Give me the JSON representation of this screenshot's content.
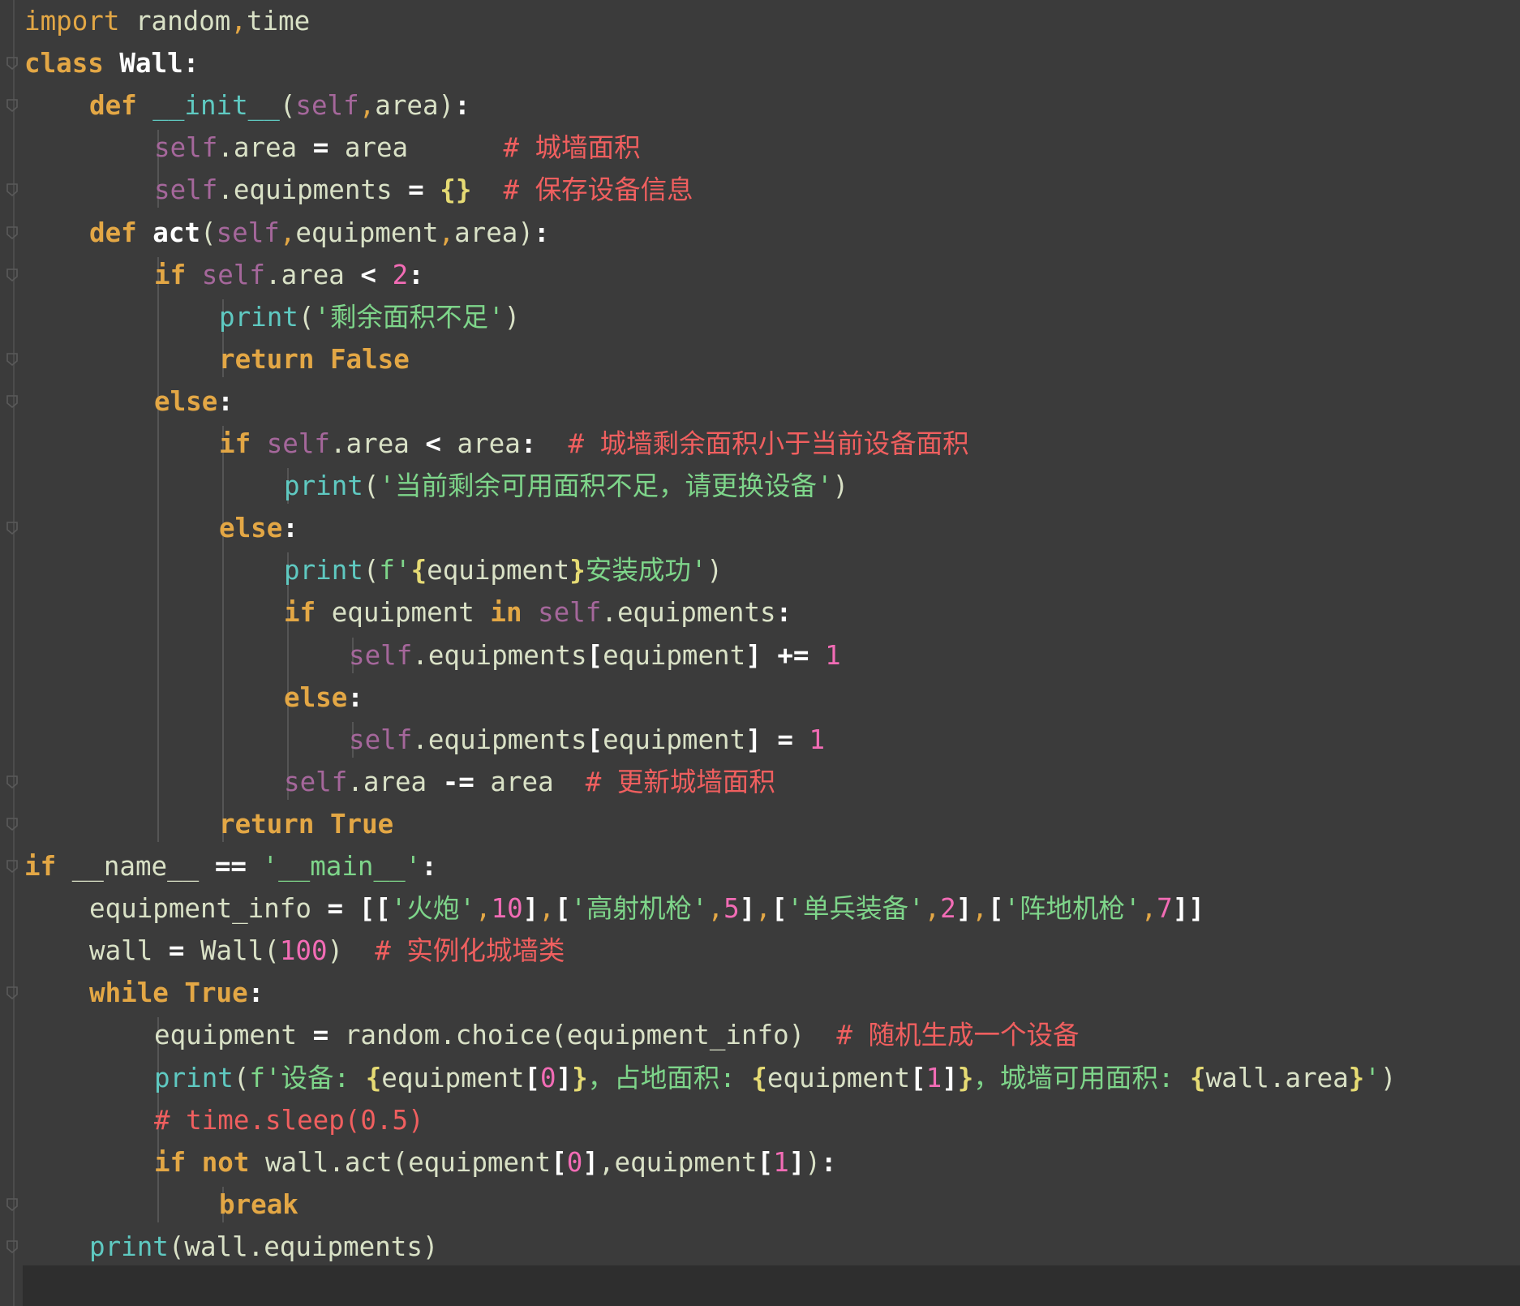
{
  "editor": {
    "language": "python",
    "theme_colors": {
      "background": "#3b3b3b",
      "keyword": "#e3a745",
      "self": "#a5679b",
      "builtin": "#5fc9c1",
      "string": "#7ed58a",
      "number": "#f26cb5",
      "comment": "#f05f5f",
      "default": "#d9e1c6"
    },
    "lines": [
      {
        "indent": 0,
        "segments": [
          [
            "kw2",
            "import"
          ],
          [
            "dn",
            " random"
          ],
          [
            "kw2",
            ","
          ],
          [
            "dn",
            "time"
          ]
        ]
      },
      {
        "indent": 0,
        "segments": [
          [
            "kw",
            "class"
          ],
          [
            "dn",
            " "
          ],
          [
            "cls",
            "Wall"
          ],
          [
            "op",
            ":"
          ]
        ]
      },
      {
        "indent": 1,
        "segments": [
          [
            "kw",
            "def"
          ],
          [
            "dn",
            " "
          ],
          [
            "fn",
            "__init__"
          ],
          [
            "dn",
            "("
          ],
          [
            "slf",
            "self"
          ],
          [
            "kw2",
            ","
          ],
          [
            "dn",
            "area"
          ],
          [
            "dn",
            ")"
          ],
          [
            "op",
            ":"
          ]
        ]
      },
      {
        "indent": 2,
        "segments": [
          [
            "slf",
            "self"
          ],
          [
            "dn",
            ".area "
          ],
          [
            "op",
            "="
          ],
          [
            "dn",
            " area      "
          ],
          [
            "cm",
            "# 城墙面积"
          ]
        ]
      },
      {
        "indent": 2,
        "segments": [
          [
            "slf",
            "self"
          ],
          [
            "dn",
            ".equipments "
          ],
          [
            "op",
            "="
          ],
          [
            "dn",
            " "
          ],
          [
            "brace",
            "{}"
          ],
          [
            "dn",
            "  "
          ],
          [
            "cm",
            "# 保存设备信息"
          ]
        ]
      },
      {
        "indent": 1,
        "segments": [
          [
            "kw",
            "def"
          ],
          [
            "dn",
            " "
          ],
          [
            "call",
            "act"
          ],
          [
            "dn",
            "("
          ],
          [
            "slf",
            "self"
          ],
          [
            "kw2",
            ","
          ],
          [
            "dn",
            "equipment"
          ],
          [
            "kw2",
            ","
          ],
          [
            "dn",
            "area"
          ],
          [
            "dn",
            ")"
          ],
          [
            "op",
            ":"
          ]
        ]
      },
      {
        "indent": 2,
        "segments": [
          [
            "kw",
            "if"
          ],
          [
            "dn",
            " "
          ],
          [
            "slf",
            "self"
          ],
          [
            "dn",
            ".area "
          ],
          [
            "op",
            "<"
          ],
          [
            "dn",
            " "
          ],
          [
            "num",
            "2"
          ],
          [
            "op",
            ":"
          ]
        ]
      },
      {
        "indent": 3,
        "segments": [
          [
            "fn",
            "print"
          ],
          [
            "dn",
            "("
          ],
          [
            "str",
            "'剩余面积不足'"
          ],
          [
            "dn",
            ")"
          ]
        ]
      },
      {
        "indent": 3,
        "segments": [
          [
            "kw",
            "return"
          ],
          [
            "dn",
            " "
          ],
          [
            "kw",
            "False"
          ]
        ]
      },
      {
        "indent": 2,
        "segments": [
          [
            "kw",
            "else"
          ],
          [
            "op",
            ":"
          ]
        ]
      },
      {
        "indent": 3,
        "segments": [
          [
            "kw",
            "if"
          ],
          [
            "dn",
            " "
          ],
          [
            "slf",
            "self"
          ],
          [
            "dn",
            ".area "
          ],
          [
            "op",
            "<"
          ],
          [
            "dn",
            " area"
          ],
          [
            "op",
            ":"
          ],
          [
            "dn",
            "  "
          ],
          [
            "cm",
            "# 城墙剩余面积小于当前设备面积"
          ]
        ]
      },
      {
        "indent": 4,
        "segments": [
          [
            "fn",
            "print"
          ],
          [
            "dn",
            "("
          ],
          [
            "str",
            "'当前剩余可用面积不足，请更换设备'"
          ],
          [
            "dn",
            ")"
          ]
        ]
      },
      {
        "indent": 3,
        "segments": [
          [
            "kw",
            "else"
          ],
          [
            "op",
            ":"
          ]
        ]
      },
      {
        "indent": 4,
        "segments": [
          [
            "fn",
            "print"
          ],
          [
            "dn",
            "("
          ],
          [
            "str",
            "f'"
          ],
          [
            "brace",
            "{"
          ],
          [
            "dn",
            "equipment"
          ],
          [
            "brace",
            "}"
          ],
          [
            "str",
            "安装成功'"
          ],
          [
            "dn",
            ")"
          ]
        ]
      },
      {
        "indent": 4,
        "segments": [
          [
            "kw",
            "if"
          ],
          [
            "dn",
            " equipment "
          ],
          [
            "kw",
            "in"
          ],
          [
            "dn",
            " "
          ],
          [
            "slf",
            "self"
          ],
          [
            "dn",
            ".equipments"
          ],
          [
            "op",
            ":"
          ]
        ]
      },
      {
        "indent": 5,
        "segments": [
          [
            "slf",
            "self"
          ],
          [
            "dn",
            ".equipments"
          ],
          [
            "op",
            "["
          ],
          [
            "dn",
            "equipment"
          ],
          [
            "op",
            "]"
          ],
          [
            "dn",
            " "
          ],
          [
            "op",
            "+="
          ],
          [
            "dn",
            " "
          ],
          [
            "num",
            "1"
          ]
        ]
      },
      {
        "indent": 4,
        "segments": [
          [
            "kw",
            "else"
          ],
          [
            "op",
            ":"
          ]
        ]
      },
      {
        "indent": 5,
        "segments": [
          [
            "slf",
            "self"
          ],
          [
            "dn",
            ".equipments"
          ],
          [
            "op",
            "["
          ],
          [
            "dn",
            "equipment"
          ],
          [
            "op",
            "]"
          ],
          [
            "dn",
            " "
          ],
          [
            "op",
            "="
          ],
          [
            "dn",
            " "
          ],
          [
            "num",
            "1"
          ]
        ]
      },
      {
        "indent": 4,
        "segments": [
          [
            "slf",
            "self"
          ],
          [
            "dn",
            ".area "
          ],
          [
            "op",
            "-="
          ],
          [
            "dn",
            " area  "
          ],
          [
            "cm",
            "# 更新城墙面积"
          ]
        ]
      },
      {
        "indent": 3,
        "segments": [
          [
            "kw",
            "return"
          ],
          [
            "dn",
            " "
          ],
          [
            "kw",
            "True"
          ]
        ]
      },
      {
        "indent": 0,
        "segments": [
          [
            "kw",
            "if"
          ],
          [
            "dn",
            " __name__ "
          ],
          [
            "op",
            "=="
          ],
          [
            "dn",
            " "
          ],
          [
            "str",
            "'__main__'"
          ],
          [
            "op",
            ":"
          ]
        ]
      },
      {
        "indent": 1,
        "segments": [
          [
            "dn",
            "equipment_info "
          ],
          [
            "op",
            "="
          ],
          [
            "dn",
            " "
          ],
          [
            "op",
            "[["
          ],
          [
            "str",
            "'火炮'"
          ],
          [
            "kw2",
            ","
          ],
          [
            "num",
            "10"
          ],
          [
            "op",
            "]"
          ],
          [
            "kw2",
            ","
          ],
          [
            "op",
            "["
          ],
          [
            "str",
            "'高射机枪'"
          ],
          [
            "kw2",
            ","
          ],
          [
            "num",
            "5"
          ],
          [
            "op",
            "]"
          ],
          [
            "kw2",
            ","
          ],
          [
            "op",
            "["
          ],
          [
            "str",
            "'单兵装备'"
          ],
          [
            "kw2",
            ","
          ],
          [
            "num",
            "2"
          ],
          [
            "op",
            "]"
          ],
          [
            "kw2",
            ","
          ],
          [
            "op",
            "["
          ],
          [
            "str",
            "'阵地机枪'"
          ],
          [
            "kw2",
            ","
          ],
          [
            "num",
            "7"
          ],
          [
            "op",
            "]]"
          ]
        ]
      },
      {
        "indent": 1,
        "segments": [
          [
            "dn",
            "wall "
          ],
          [
            "op",
            "="
          ],
          [
            "dn",
            " Wall("
          ],
          [
            "num",
            "100"
          ],
          [
            "dn",
            ")  "
          ],
          [
            "cm",
            "# 实例化城墙类"
          ]
        ]
      },
      {
        "indent": 1,
        "segments": [
          [
            "kw",
            "while"
          ],
          [
            "dn",
            " "
          ],
          [
            "kw",
            "True"
          ],
          [
            "op",
            ":"
          ]
        ]
      },
      {
        "indent": 2,
        "segments": [
          [
            "dn",
            "equipment "
          ],
          [
            "op",
            "="
          ],
          [
            "dn",
            " random.choice(equipment_info)  "
          ],
          [
            "cm",
            "# 随机生成一个设备"
          ]
        ]
      },
      {
        "indent": 2,
        "segments": [
          [
            "fn",
            "print"
          ],
          [
            "dn",
            "("
          ],
          [
            "str",
            "f'设备: "
          ],
          [
            "brace",
            "{"
          ],
          [
            "dn",
            "equipment"
          ],
          [
            "op",
            "["
          ],
          [
            "num",
            "0"
          ],
          [
            "op",
            "]"
          ],
          [
            "brace",
            "}"
          ],
          [
            "str",
            "，占地面积: "
          ],
          [
            "brace",
            "{"
          ],
          [
            "dn",
            "equipment"
          ],
          [
            "op",
            "["
          ],
          [
            "num",
            "1"
          ],
          [
            "op",
            "]"
          ],
          [
            "brace",
            "}"
          ],
          [
            "str",
            "，城墙可用面积: "
          ],
          [
            "brace",
            "{"
          ],
          [
            "dn",
            "wall.area"
          ],
          [
            "brace",
            "}"
          ],
          [
            "str",
            "'"
          ],
          [
            "dn",
            ")"
          ]
        ]
      },
      {
        "indent": 2,
        "segments": [
          [
            "cm",
            "# time.sleep(0.5)"
          ]
        ]
      },
      {
        "indent": 2,
        "segments": [
          [
            "kw",
            "if"
          ],
          [
            "dn",
            " "
          ],
          [
            "kw",
            "not"
          ],
          [
            "dn",
            " wall.act(equipment"
          ],
          [
            "op",
            "["
          ],
          [
            "num",
            "0"
          ],
          [
            "op",
            "]"
          ],
          [
            "dn",
            ",equipment"
          ],
          [
            "op",
            "["
          ],
          [
            "num",
            "1"
          ],
          [
            "op",
            "]"
          ],
          [
            "dn",
            ")"
          ],
          [
            "op",
            ":"
          ]
        ]
      },
      {
        "indent": 3,
        "segments": [
          [
            "kw",
            "break"
          ]
        ]
      },
      {
        "indent": 1,
        "segments": [
          [
            "fn",
            "print"
          ],
          [
            "dn",
            "(wall.equipments)"
          ]
        ]
      }
    ]
  }
}
